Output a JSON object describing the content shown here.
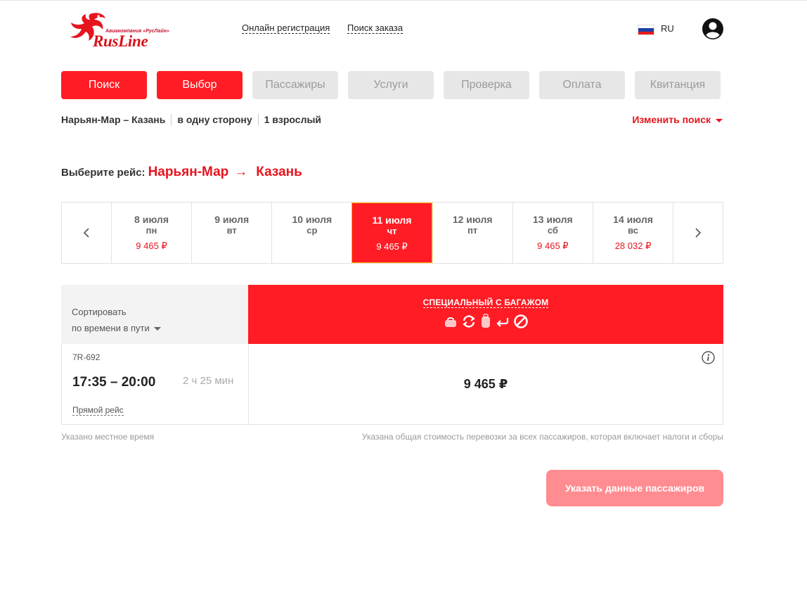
{
  "header": {
    "logo_caption": "Авиакомпания «РусЛайн»",
    "logo_word": "RusLine",
    "links": [
      "Онлайн регистрация",
      "Поиск заказа"
    ],
    "language": "RU",
    "flag_colors": [
      "#ffffff",
      "#1c3fa8",
      "#e51a1a"
    ]
  },
  "steps": [
    {
      "label": "Поиск",
      "active": true
    },
    {
      "label": "Выбор",
      "active": true
    },
    {
      "label": "Пассажиры",
      "active": false
    },
    {
      "label": "Услуги",
      "active": false
    },
    {
      "label": "Проверка",
      "active": false
    },
    {
      "label": "Оплата",
      "active": false
    },
    {
      "label": "Квитанция",
      "active": false
    }
  ],
  "summary": {
    "route": "Нарьян-Мар – Казань",
    "trip_type": "в одну сторону",
    "passengers": "1 взрослый",
    "change_search": "Изменить поиск"
  },
  "choose": {
    "label": "Выберите рейс:",
    "from": "Нарьян-Мар",
    "arrow": "→",
    "to": "Казань"
  },
  "dates": [
    {
      "date": "8 июля",
      "weekday": "пн",
      "price": "9 465 ₽",
      "selected": false
    },
    {
      "date": "9 июля",
      "weekday": "вт",
      "price": "",
      "selected": false
    },
    {
      "date": "10 июля",
      "weekday": "ср",
      "price": "",
      "selected": false
    },
    {
      "date": "11 июля",
      "weekday": "чт",
      "price": "9 465 ₽",
      "selected": true
    },
    {
      "date": "12 июля",
      "weekday": "пт",
      "price": "",
      "selected": false
    },
    {
      "date": "13 июля",
      "weekday": "сб",
      "price": "9 465 ₽",
      "selected": false
    },
    {
      "date": "14 июля",
      "weekday": "вс",
      "price": "28 032 ₽",
      "selected": false
    }
  ],
  "sort": {
    "label": "Сортировать",
    "value": "по времени в пути"
  },
  "fare": {
    "name": "СПЕЦИАЛЬНЫЙ С БАГАЖОМ",
    "icons": [
      "hand-bag-icon",
      "exchange-icon",
      "luggage-icon",
      "refund-icon",
      "no-refund-icon"
    ]
  },
  "flight": {
    "number": "7R-692",
    "time": "17:35 – 20:00",
    "duration": "2 ч 25 мин",
    "type": "Прямой рейс",
    "price": "9 465 ₽"
  },
  "notes": {
    "left": "Указано местное время",
    "right": "Указана общая стоимость перевозки за всех пассажиров, которая включает налоги и сборы"
  },
  "submit_label": "Указать данные пассажиров",
  "colors": {
    "accent": "#ff1c24",
    "submit_disabled": "#ff8c90"
  }
}
